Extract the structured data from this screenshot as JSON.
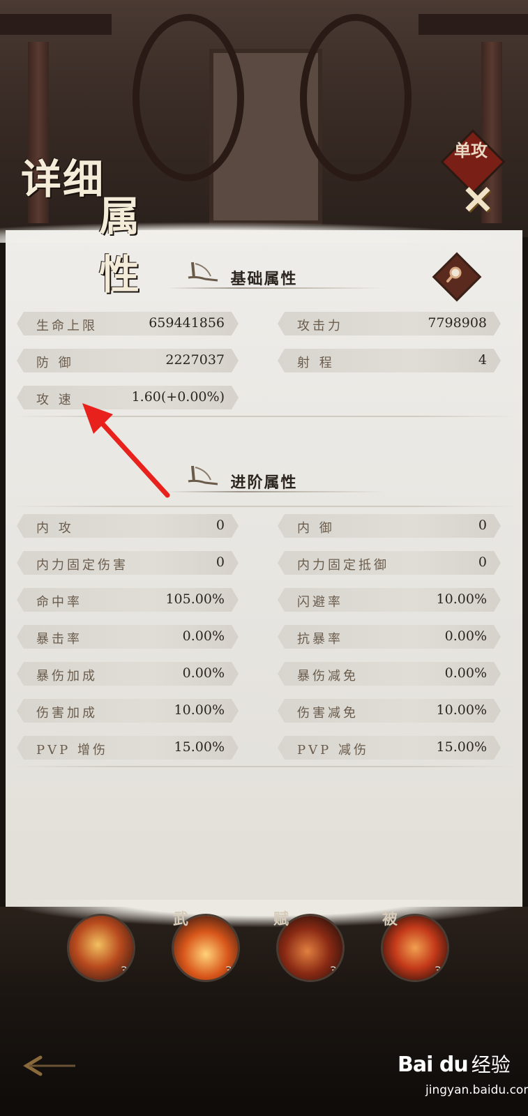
{
  "title": {
    "line1": "详细",
    "line2": "属性"
  },
  "badge": {
    "label": "单攻"
  },
  "close_glyph": "✕",
  "basic": {
    "title": "基础属性",
    "stats": [
      {
        "label": "生命上限",
        "value": "659441856"
      },
      {
        "label": "攻击力",
        "value": "7798908"
      },
      {
        "label": "防 御",
        "value": "2227037"
      },
      {
        "label": "射 程",
        "value": "4"
      },
      {
        "label": "攻 速",
        "value": "1.60(+0.00%)"
      }
    ]
  },
  "advanced": {
    "title": "进阶属性",
    "stats": [
      {
        "label": "内 攻",
        "value": "0"
      },
      {
        "label": "内 御",
        "value": "0"
      },
      {
        "label": "内力固定伤害",
        "value": "0"
      },
      {
        "label": "内力固定抵御",
        "value": "0"
      },
      {
        "label": "命中率",
        "value": "105.00%"
      },
      {
        "label": "闪避率",
        "value": "10.00%"
      },
      {
        "label": "暴击率",
        "value": "0.00%"
      },
      {
        "label": "抗暴率",
        "value": "0.00%"
      },
      {
        "label": "暴伤加成",
        "value": "0.00%"
      },
      {
        "label": "暴伤减免",
        "value": "0.00%"
      },
      {
        "label": "伤害加成",
        "value": "10.00%"
      },
      {
        "label": "伤害减免",
        "value": "10.00%"
      },
      {
        "label": "PVP 增伤",
        "value": "15.00%"
      },
      {
        "label": "PVP 减伤",
        "value": "15.00%"
      }
    ]
  },
  "skills": [
    {
      "tag": "",
      "level": "3",
      "color": "#b84a1e"
    },
    {
      "tag": "武",
      "level": "3",
      "color": "#d8561a"
    },
    {
      "tag": "赋",
      "level": "3",
      "color": "#8a2a14"
    },
    {
      "tag": "被",
      "level": "3",
      "color": "#c43a1a"
    }
  ],
  "watermark": {
    "logo": "Bai du",
    "cn": "经验",
    "url": "jingyan.baidu.com"
  },
  "colors": {
    "accent": "#7a1f15",
    "arrow": "#e8211c",
    "panel": "#eeede9"
  }
}
